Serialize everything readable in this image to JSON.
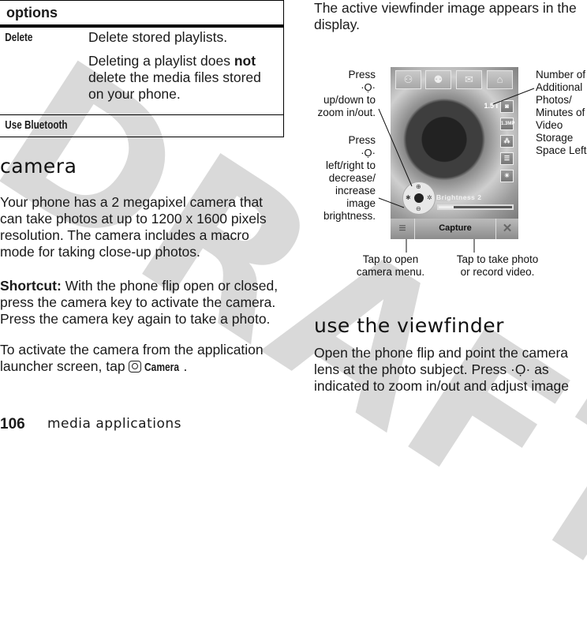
{
  "watermark": "DRAFT",
  "options_table": {
    "header": "options",
    "rows": [
      {
        "key": "Delete",
        "description": "Delete stored playlists.",
        "note_before": "Deleting a playlist does ",
        "note_bold": "not",
        "note_after": " delete the media files stored on your phone."
      },
      {
        "key": "Use Bluetooth",
        "description": ""
      }
    ]
  },
  "camera_section": {
    "heading": "camera",
    "intro": "Your phone has a 2 megapixel camera that can take photos at up to 1200 x 1600 pixels resolution. The camera includes a macro mode for taking close-up photos.",
    "shortcut_label": "Shortcut:",
    "shortcut_text": " With the phone flip open or closed, press the camera key to activate the camera. Press the camera key again to take a photo.",
    "activate_text": "To activate the camera from the application launcher screen, tap ",
    "camera_icon": "camera-icon",
    "camera_label": "Camera",
    "activate_end": "."
  },
  "viewfinder_intro": "The active viewfinder image appears in the display.",
  "viewfinder_diagram": {
    "top_buttons": [
      "contacts-icon",
      "group-icon",
      "message-icon",
      "home-icon"
    ],
    "photos_left": "1.5 i",
    "side_icons": [
      {
        "icon": "camera-mode-icon",
        "glyph": "◙"
      },
      {
        "icon": "resolution-icon",
        "glyph": "1.3MP"
      },
      {
        "icon": "scene-icon",
        "glyph": "⁂"
      },
      {
        "icon": "storage-icon",
        "glyph": "☰"
      },
      {
        "icon": "lighting-icon",
        "glyph": "☀"
      }
    ],
    "brightness_label": "Brightness 2",
    "brightness_level": 0.2,
    "capture_label": "Capture",
    "menu_icon": "≡",
    "close_icon": "✕",
    "callouts": {
      "zoom_press": "Press",
      "zoom_rest": [
        "up/down to",
        "zoom in/out."
      ],
      "brightness_press": "Press",
      "brightness_rest": [
        "left/right to",
        "decrease/",
        "increase",
        "image",
        "brightness."
      ],
      "storage": [
        "Number of",
        "Additional",
        "Photos/",
        "Minutes of",
        "Video",
        "Storage",
        "Space Left"
      ],
      "menu": [
        "Tap to open",
        "camera menu."
      ],
      "capture": [
        "Tap to take photo",
        "or record video."
      ]
    }
  },
  "use_viewfinder": {
    "heading": "use the viewfinder",
    "text_before": "Open the phone flip and point the camera lens at the photo subject. Press ",
    "nav_key": "·Ọ·",
    "text_after": " as indicated to zoom in/out and adjust image"
  },
  "footer": {
    "page_number": "106",
    "section_title": "media applications"
  }
}
